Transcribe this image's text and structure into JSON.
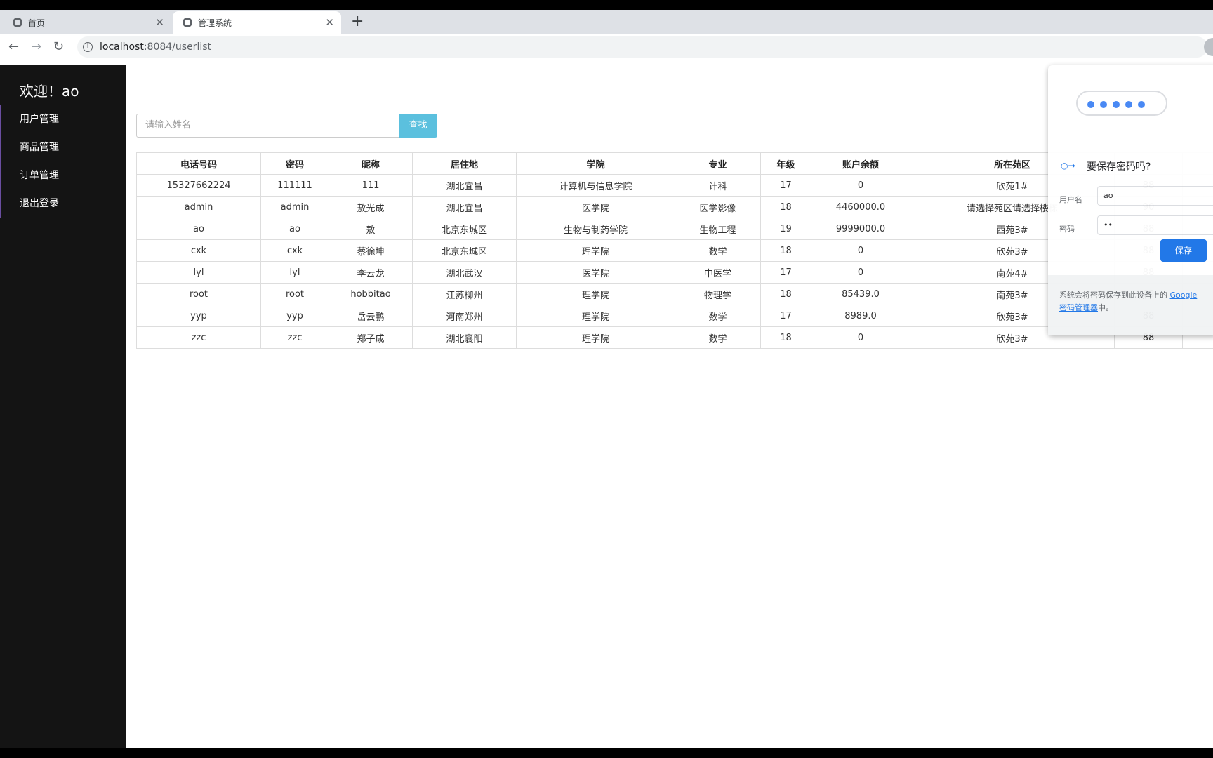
{
  "browser": {
    "tabs": [
      {
        "title": "首页",
        "active": false
      },
      {
        "title": "管理系统",
        "active": true
      }
    ],
    "url_host": "localhost",
    "url_path": ":8084/userlist"
  },
  "sidebar": {
    "welcome": "欢迎！ao",
    "items": [
      {
        "label": "用户管理"
      },
      {
        "label": "商品管理"
      },
      {
        "label": "订单管理"
      },
      {
        "label": "退出登录"
      }
    ]
  },
  "search": {
    "placeholder": "请输入姓名",
    "button_label": "查找"
  },
  "table": {
    "headers": [
      "电话号码",
      "密码",
      "昵称",
      "居住地",
      "学院",
      "专业",
      "年级",
      "账户余额",
      "所在苑区",
      "",
      ""
    ],
    "rows": [
      [
        "15327662224",
        "111111",
        "111",
        "湖北宜昌",
        "计算机与信息学院",
        "计科",
        "17",
        "0",
        "欣苑1#",
        "88",
        ""
      ],
      [
        "admin",
        "admin",
        "敖光成",
        "湖北宜昌",
        "医学院",
        "医学影像",
        "18",
        "4460000.0",
        "请选择苑区请选择楼栋",
        "90",
        ""
      ],
      [
        "ao",
        "ao",
        "敖",
        "北京东城区",
        "生物与制药学院",
        "生物工程",
        "19",
        "9999000.0",
        "西苑3#",
        "88",
        ""
      ],
      [
        "cxk",
        "cxk",
        "蔡徐坤",
        "北京东城区",
        "理学院",
        "数学",
        "18",
        "0",
        "欣苑3#",
        "88",
        ""
      ],
      [
        "lyl",
        "lyl",
        "李云龙",
        "湖北武汉",
        "医学院",
        "中医学",
        "17",
        "0",
        "南苑4#",
        "88",
        ""
      ],
      [
        "root",
        "root",
        "hobbitao",
        "江苏柳州",
        "理学院",
        "物理学",
        "18",
        "85439.0",
        "南苑3#",
        "88",
        ""
      ],
      [
        "yyp",
        "yyp",
        "岳云鹏",
        "河南郑州",
        "理学院",
        "数学",
        "17",
        "8989.0",
        "欣苑3#",
        "88",
        ""
      ],
      [
        "zzc",
        "zzc",
        "郑子成",
        "湖北襄阳",
        "理学院",
        "数学",
        "18",
        "0",
        "欣苑3#",
        "88",
        ""
      ]
    ]
  },
  "password_popup": {
    "title": "要保存密码吗?",
    "username_label": "用户名",
    "username_value": "ao",
    "password_label": "密码",
    "password_value": "••",
    "save_label": "保存",
    "footer_text": "系统会将密码保存到此设备上的",
    "footer_link": "Google 密码管理器",
    "footer_tail": "中。"
  },
  "colors": {
    "sidebar_bg": "#141414",
    "search_button": "#5bc0de",
    "save_button": "#1a73e8"
  }
}
